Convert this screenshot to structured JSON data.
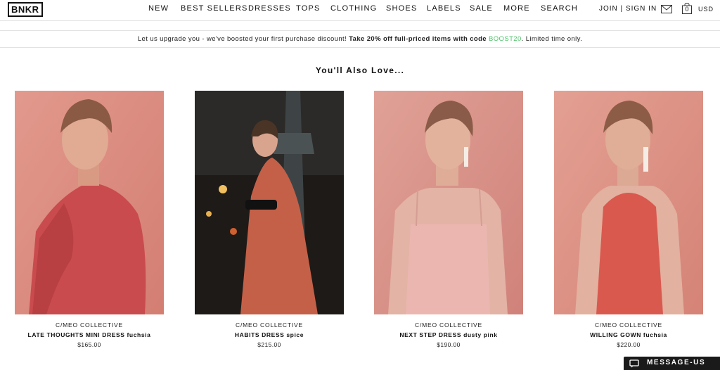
{
  "brand": {
    "logo": "BNKR"
  },
  "nav": {
    "items": [
      {
        "label": "NEW",
        "id": "new"
      },
      {
        "label": "BEST SELLERS",
        "id": "best-sellers"
      },
      {
        "label": "DRESSES",
        "id": "dresses"
      },
      {
        "label": "TOPS",
        "id": "tops"
      },
      {
        "label": "CLOTHING",
        "id": "clothing"
      },
      {
        "label": "SHOES",
        "id": "shoes"
      },
      {
        "label": "LABELS",
        "id": "labels"
      },
      {
        "label": "SALE",
        "id": "sale"
      },
      {
        "label": "MORE",
        "id": "more"
      },
      {
        "label": "SEARCH",
        "id": "search"
      }
    ]
  },
  "account": {
    "join": "JOIN",
    "separator": " | ",
    "signin": "SIGN IN",
    "bag_count": "0",
    "currency": "USD"
  },
  "icons": {
    "mail": "envelope-icon",
    "bag": "shopping-bag-icon",
    "message": "chat-bubble-icon"
  },
  "promo": {
    "lead": "Let us upgrade you - we've boosted your first purchase discount!",
    "offer": "Take 20% off full-priced items with code",
    "code": "BOOST20",
    "tail": ". Limited time only."
  },
  "colors": {
    "promo_code": "#4fc36a",
    "dark": "#1a1a1a"
  },
  "section": {
    "title": "You'll Also Love..."
  },
  "products": [
    {
      "brand": "C/MEO COLLECTIVE",
      "name": "LATE THOUGHTS MINI DRESS fuchsia",
      "price": "$165.00"
    },
    {
      "brand": "C/MEO COLLECTIVE",
      "name": "HABITS DRESS spice",
      "price": "$215.00"
    },
    {
      "brand": "C/MEO COLLECTIVE",
      "name": "NEXT STEP DRESS dusty pink",
      "price": "$190.00"
    },
    {
      "brand": "C/MEO COLLECTIVE",
      "name": "WILLING GOWN fuchsia",
      "price": "$220.00"
    }
  ],
  "message_button": {
    "label": "MESSAGE-US"
  }
}
